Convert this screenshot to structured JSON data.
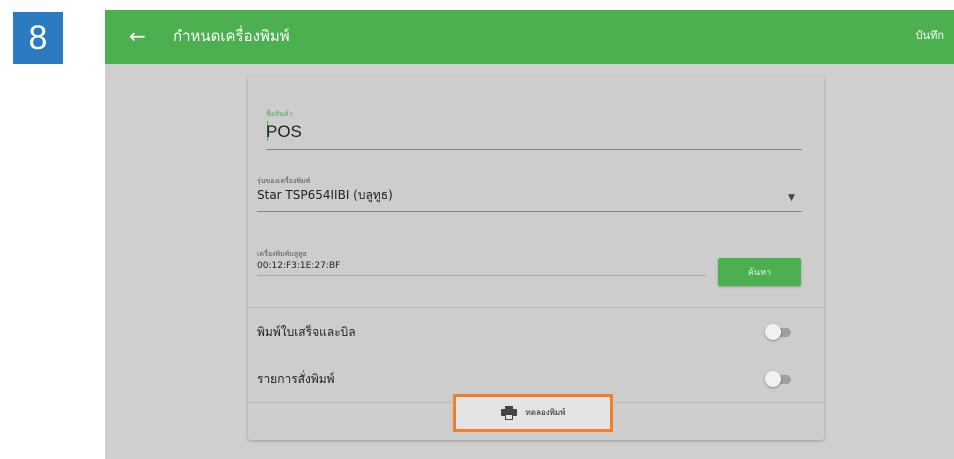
{
  "step_badge": "8",
  "topbar": {
    "back_icon": "arrow-back-icon",
    "title": "กำหนดเครื่องพิมพ์",
    "save_label": "บันทึก"
  },
  "form": {
    "product_name_label": "ชื่อสินค้า",
    "product_name_value": "POS",
    "printer_model_label": "รุ่นของเครื่องพิมพ์",
    "printer_model_value": "Star TSP654IIBI (บลูทูธ)",
    "bluetooth_printer_label": "เครื่องพิมพ์บลูทูธ",
    "bluetooth_printer_value": "00:12:F3:1E:27:BF",
    "search_button_label": "ค้นหา"
  },
  "toggles": [
    {
      "label": "พิมพ์ใบเสร็จและบิล",
      "enabled": false
    },
    {
      "label": "รายการสั่งพิมพ์",
      "enabled": false
    }
  ],
  "test_print": {
    "icon": "printer-icon",
    "label": "ทดลองพิมพ์"
  },
  "colors": {
    "primary": "#4caf50",
    "badge": "#2b7bc0",
    "highlight": "#f07f2c"
  }
}
